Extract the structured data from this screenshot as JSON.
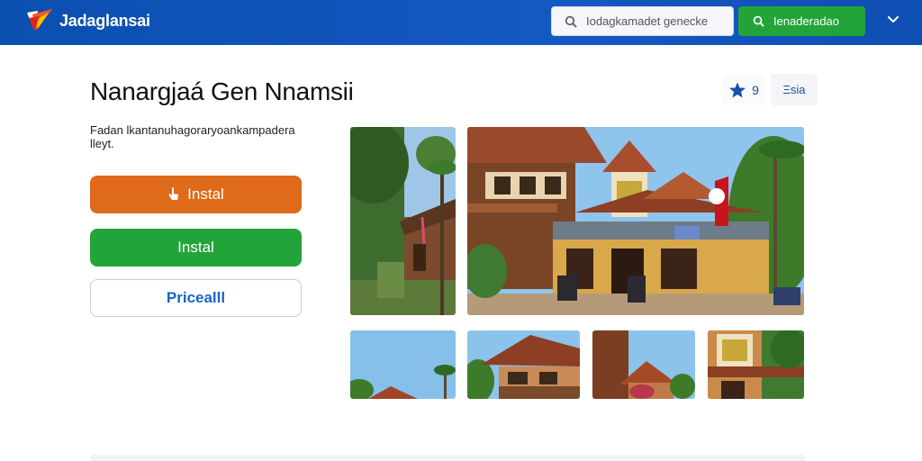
{
  "header": {
    "brand_name": "Jadaglansai",
    "brand_logo": "brand-logo-icon",
    "search_placeholder": "Iodagkamadet genecke",
    "search_icon": "search-icon",
    "action_label": "Ienaderadao",
    "action_icon": "search-icon",
    "menu_icon": "chevron-down-icon",
    "colors": {
      "bar": "#1458c2",
      "action": "#22a43a"
    }
  },
  "app": {
    "title": "Nanargjaá Gen Nnamsii",
    "description": "Fadan lkantanuhagoraryoankampadera lleyt.",
    "rating_value": "9",
    "rating_icon": "star-icon",
    "info_label": "Ξsia",
    "buttons": {
      "primary_label": "Instal",
      "primary_icon": "hand-pointer-icon",
      "secondary_label": "Instal",
      "tertiary_label": "Pricealll"
    },
    "colors": {
      "primary": "#de6a1a",
      "secondary": "#22a43a",
      "link": "#1a64c8"
    }
  },
  "gallery": {
    "screenshots": [
      {
        "name": "screenshot-village-lane"
      },
      {
        "name": "screenshot-traditional-house-main"
      },
      {
        "name": "screenshot-thumb-sky-roof"
      },
      {
        "name": "screenshot-thumb-house-front"
      },
      {
        "name": "screenshot-thumb-gable"
      },
      {
        "name": "screenshot-thumb-signboard"
      }
    ]
  }
}
